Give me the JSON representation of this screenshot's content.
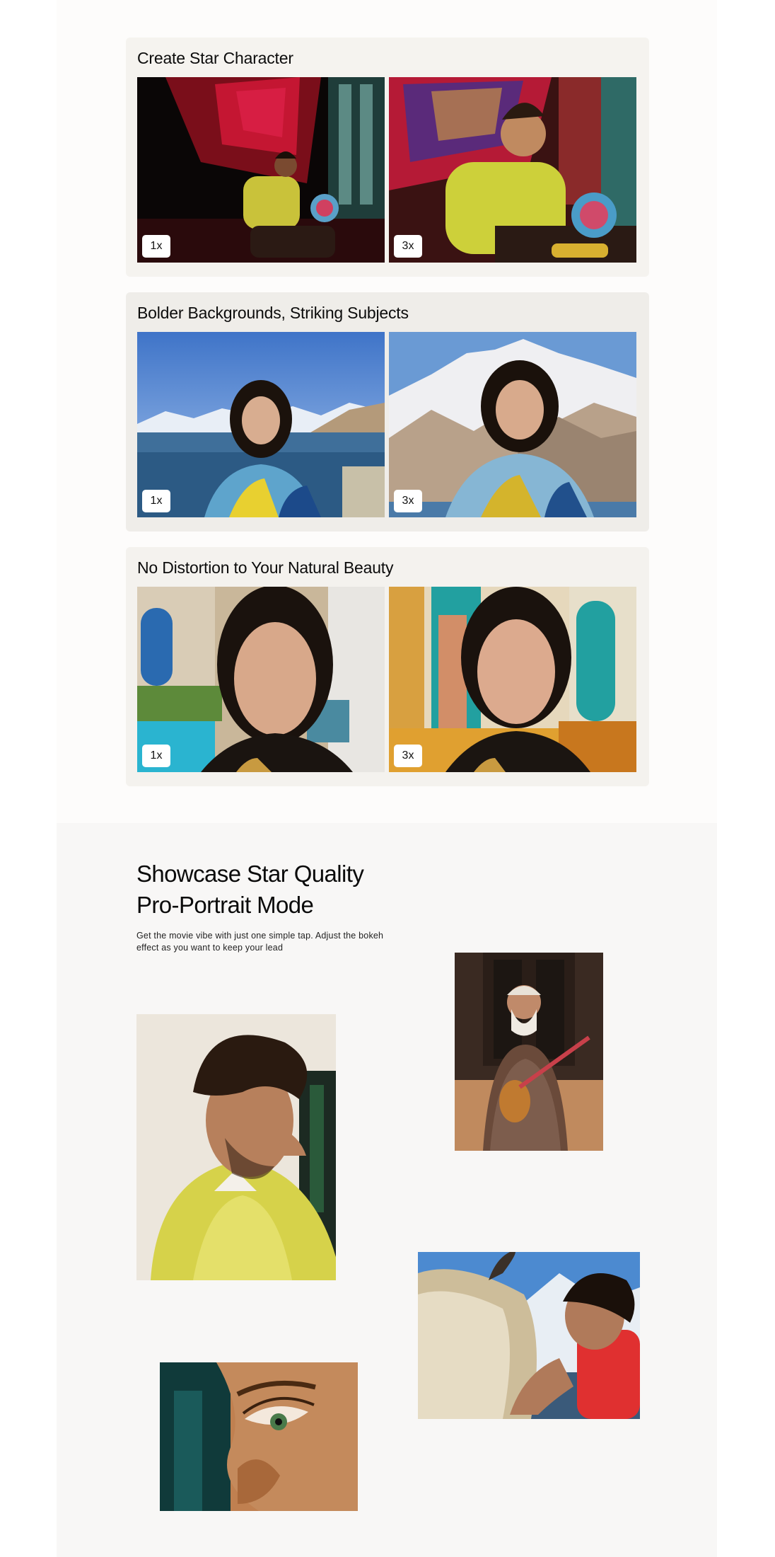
{
  "cards": [
    {
      "title": "Create Star Character",
      "left_badge": "1x",
      "right_badge": "3x",
      "bg": "#f5f3ef"
    },
    {
      "title": "Bolder Backgrounds, Striking Subjects",
      "left_badge": "1x",
      "right_badge": "3x",
      "bg": "#efede9"
    },
    {
      "title": "No Distortion to Your Natural Beauty",
      "left_badge": "1x",
      "right_badge": "3x",
      "bg": "#f4f2ee"
    }
  ],
  "portrait_section": {
    "headline_line1": "Showcase Star Quality",
    "headline_line2": "Pro-Portrait Mode",
    "description": "Get the movie vibe with just one simple tap. Adjust the bokeh effect as you want to keep your lead"
  },
  "colors": {
    "page_bg": "#ffffff",
    "section_bg": "#f8f7f6",
    "badge_bg": "#ffffff",
    "text": "#111111"
  }
}
